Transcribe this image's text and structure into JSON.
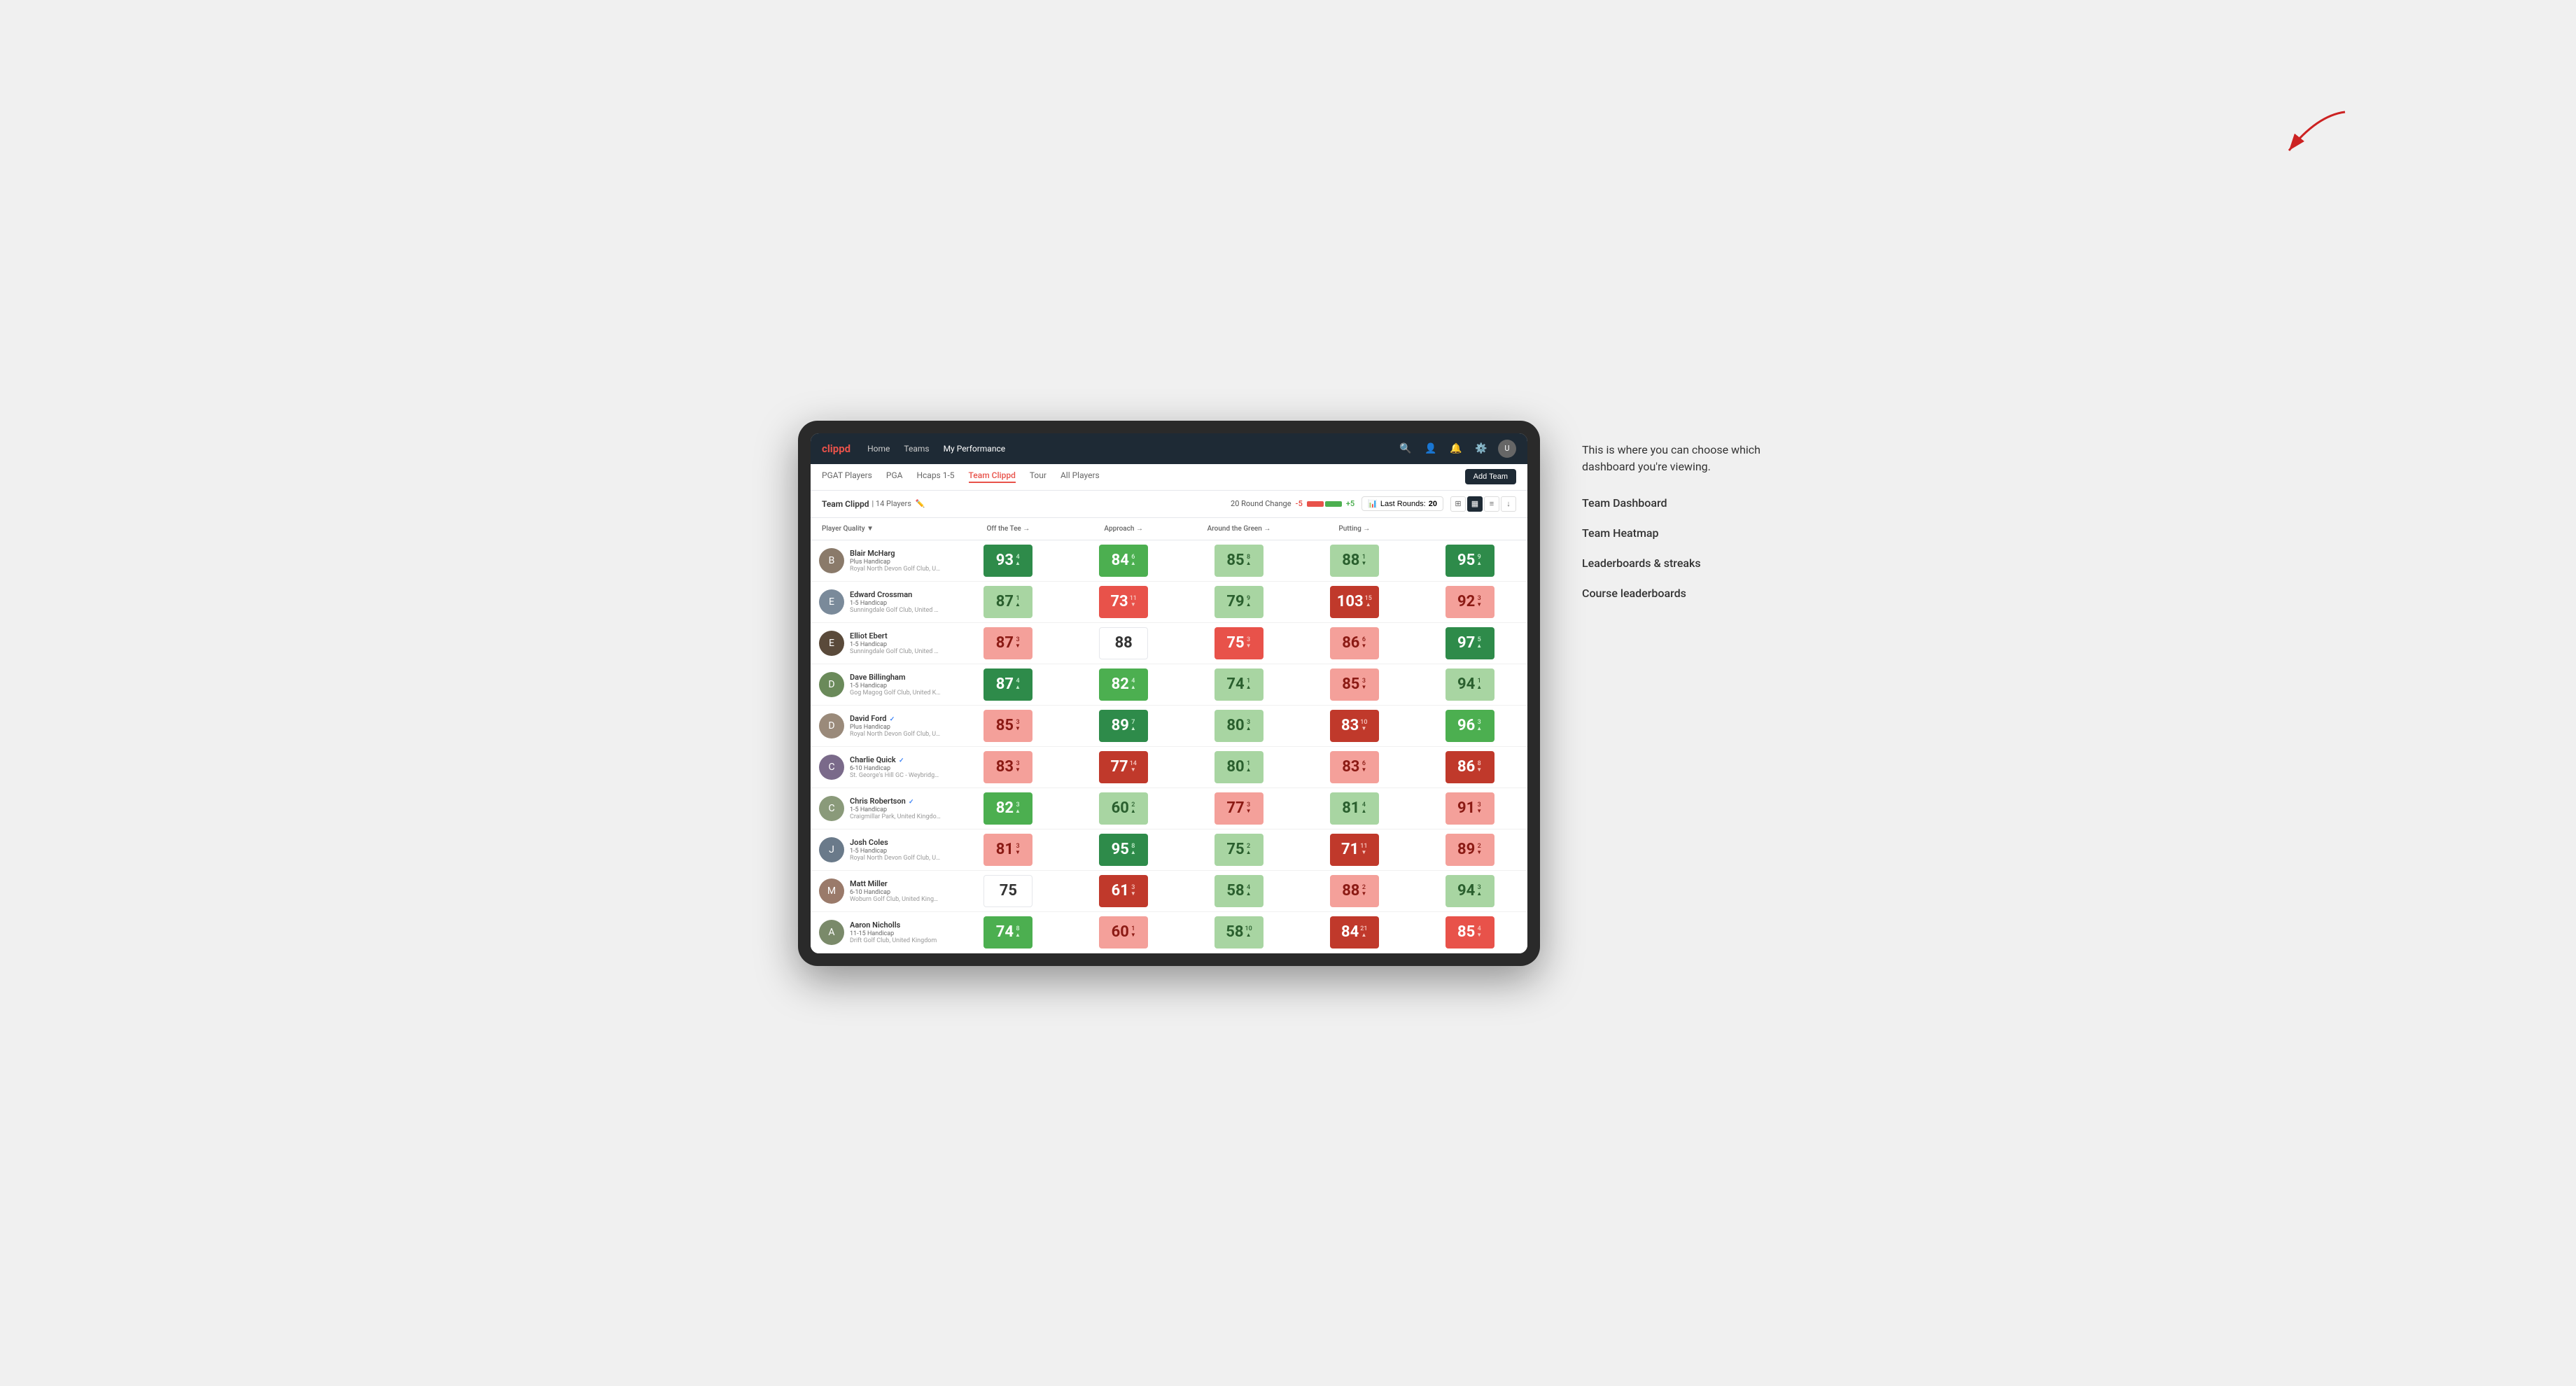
{
  "annotation": {
    "intro_text": "This is where you can choose which dashboard you're viewing.",
    "items": [
      "Team Dashboard",
      "Team Heatmap",
      "Leaderboards & streaks",
      "Course leaderboards"
    ]
  },
  "nav": {
    "logo": "clippd",
    "links": [
      "Home",
      "Teams",
      "My Performance"
    ],
    "active_link": "My Performance"
  },
  "sub_nav": {
    "links": [
      "PGAT Players",
      "PGA",
      "Hcaps 1-5",
      "Team Clippd",
      "Tour",
      "All Players"
    ],
    "active_link": "Team Clippd",
    "add_team_label": "Add Team"
  },
  "team_header": {
    "name": "Team Clippd",
    "separator": "|",
    "count": "14 Players",
    "round_change_label": "20 Round Change",
    "round_change_neg": "-5",
    "round_change_pos": "+5",
    "last_rounds_label": "Last Rounds:",
    "last_rounds_value": "20"
  },
  "table": {
    "columns": [
      "Player Quality ▼",
      "Off the Tee →",
      "Approach →",
      "Around the Green →",
      "Putting →"
    ],
    "rows": [
      {
        "name": "Blair McHarg",
        "handicap": "Plus Handicap",
        "club": "Royal North Devon Golf Club, United Kingdom",
        "avatar_color": "#8a7a6a",
        "scores": [
          {
            "value": "93",
            "delta": "4",
            "dir": "up",
            "color": "green-dark"
          },
          {
            "value": "84",
            "delta": "6",
            "dir": "up",
            "color": "green-med"
          },
          {
            "value": "85",
            "delta": "8",
            "dir": "up",
            "color": "green-light"
          },
          {
            "value": "88",
            "delta": "1",
            "dir": "down",
            "color": "green-light"
          },
          {
            "value": "95",
            "delta": "9",
            "dir": "up",
            "color": "green-dark"
          }
        ]
      },
      {
        "name": "Edward Crossman",
        "handicap": "1-5 Handicap",
        "club": "Sunningdale Golf Club, United Kingdom",
        "avatar_color": "#7a8a9a",
        "scores": [
          {
            "value": "87",
            "delta": "1",
            "dir": "up",
            "color": "green-light"
          },
          {
            "value": "73",
            "delta": "11",
            "dir": "down",
            "color": "red-med"
          },
          {
            "value": "79",
            "delta": "9",
            "dir": "up",
            "color": "green-light"
          },
          {
            "value": "103",
            "delta": "15",
            "dir": "up",
            "color": "red-dark"
          },
          {
            "value": "92",
            "delta": "3",
            "dir": "down",
            "color": "red-light"
          }
        ]
      },
      {
        "name": "Elliot Ebert",
        "handicap": "1-5 Handicap",
        "club": "Sunningdale Golf Club, United Kingdom",
        "avatar_color": "#5a4a3a",
        "scores": [
          {
            "value": "87",
            "delta": "3",
            "dir": "down",
            "color": "red-light"
          },
          {
            "value": "88",
            "delta": "",
            "dir": "",
            "color": "white"
          },
          {
            "value": "75",
            "delta": "3",
            "dir": "down",
            "color": "red-med"
          },
          {
            "value": "86",
            "delta": "6",
            "dir": "down",
            "color": "red-light"
          },
          {
            "value": "97",
            "delta": "5",
            "dir": "up",
            "color": "green-dark"
          }
        ]
      },
      {
        "name": "Dave Billingham",
        "handicap": "1-5 Handicap",
        "club": "Gog Magog Golf Club, United Kingdom",
        "avatar_color": "#6a8a5a",
        "scores": [
          {
            "value": "87",
            "delta": "4",
            "dir": "up",
            "color": "green-dark"
          },
          {
            "value": "82",
            "delta": "4",
            "dir": "up",
            "color": "green-med"
          },
          {
            "value": "74",
            "delta": "1",
            "dir": "up",
            "color": "green-light"
          },
          {
            "value": "85",
            "delta": "3",
            "dir": "down",
            "color": "red-light"
          },
          {
            "value": "94",
            "delta": "1",
            "dir": "up",
            "color": "green-light"
          }
        ]
      },
      {
        "name": "David Ford",
        "verified": true,
        "handicap": "Plus Handicap",
        "club": "Royal North Devon Golf Club, United Kingdom",
        "avatar_color": "#9a8a7a",
        "scores": [
          {
            "value": "85",
            "delta": "3",
            "dir": "down",
            "color": "red-light"
          },
          {
            "value": "89",
            "delta": "7",
            "dir": "up",
            "color": "green-dark"
          },
          {
            "value": "80",
            "delta": "3",
            "dir": "up",
            "color": "green-light"
          },
          {
            "value": "83",
            "delta": "10",
            "dir": "down",
            "color": "red-dark"
          },
          {
            "value": "96",
            "delta": "3",
            "dir": "up",
            "color": "green-med"
          }
        ]
      },
      {
        "name": "Charlie Quick",
        "verified": true,
        "handicap": "6-10 Handicap",
        "club": "St. George's Hill GC - Weybridge - Surrey, Uni...",
        "avatar_color": "#7a6a8a",
        "scores": [
          {
            "value": "83",
            "delta": "3",
            "dir": "down",
            "color": "red-light"
          },
          {
            "value": "77",
            "delta": "14",
            "dir": "down",
            "color": "red-dark"
          },
          {
            "value": "80",
            "delta": "1",
            "dir": "up",
            "color": "green-light"
          },
          {
            "value": "83",
            "delta": "6",
            "dir": "down",
            "color": "red-light"
          },
          {
            "value": "86",
            "delta": "8",
            "dir": "down",
            "color": "red-dark"
          }
        ]
      },
      {
        "name": "Chris Robertson",
        "verified": true,
        "handicap": "1-5 Handicap",
        "club": "Craigmillar Park, United Kingdom",
        "avatar_color": "#8a9a7a",
        "scores": [
          {
            "value": "82",
            "delta": "3",
            "dir": "up",
            "color": "green-med"
          },
          {
            "value": "60",
            "delta": "2",
            "dir": "up",
            "color": "green-light"
          },
          {
            "value": "77",
            "delta": "3",
            "dir": "down",
            "color": "red-light"
          },
          {
            "value": "81",
            "delta": "4",
            "dir": "up",
            "color": "green-light"
          },
          {
            "value": "91",
            "delta": "3",
            "dir": "down",
            "color": "red-light"
          }
        ]
      },
      {
        "name": "Josh Coles",
        "handicap": "1-5 Handicap",
        "club": "Royal North Devon Golf Club, United Kingdom",
        "avatar_color": "#6a7a8a",
        "scores": [
          {
            "value": "81",
            "delta": "3",
            "dir": "down",
            "color": "red-light"
          },
          {
            "value": "95",
            "delta": "8",
            "dir": "up",
            "color": "green-dark"
          },
          {
            "value": "75",
            "delta": "2",
            "dir": "up",
            "color": "green-light"
          },
          {
            "value": "71",
            "delta": "11",
            "dir": "down",
            "color": "red-dark"
          },
          {
            "value": "89",
            "delta": "2",
            "dir": "down",
            "color": "red-light"
          }
        ]
      },
      {
        "name": "Matt Miller",
        "handicap": "6-10 Handicap",
        "club": "Woburn Golf Club, United Kingdom",
        "avatar_color": "#9a7a6a",
        "scores": [
          {
            "value": "75",
            "delta": "",
            "dir": "",
            "color": "white"
          },
          {
            "value": "61",
            "delta": "3",
            "dir": "down",
            "color": "red-dark"
          },
          {
            "value": "58",
            "delta": "4",
            "dir": "up",
            "color": "green-light"
          },
          {
            "value": "88",
            "delta": "2",
            "dir": "down",
            "color": "red-light"
          },
          {
            "value": "94",
            "delta": "3",
            "dir": "up",
            "color": "green-light"
          }
        ]
      },
      {
        "name": "Aaron Nicholls",
        "handicap": "11-15 Handicap",
        "club": "Drift Golf Club, United Kingdom",
        "avatar_color": "#7a8a6a",
        "scores": [
          {
            "value": "74",
            "delta": "8",
            "dir": "up",
            "color": "green-med"
          },
          {
            "value": "60",
            "delta": "1",
            "dir": "down",
            "color": "red-light"
          },
          {
            "value": "58",
            "delta": "10",
            "dir": "up",
            "color": "green-light"
          },
          {
            "value": "84",
            "delta": "21",
            "dir": "up",
            "color": "red-dark"
          },
          {
            "value": "85",
            "delta": "4",
            "dir": "down",
            "color": "red-med"
          }
        ]
      }
    ]
  }
}
